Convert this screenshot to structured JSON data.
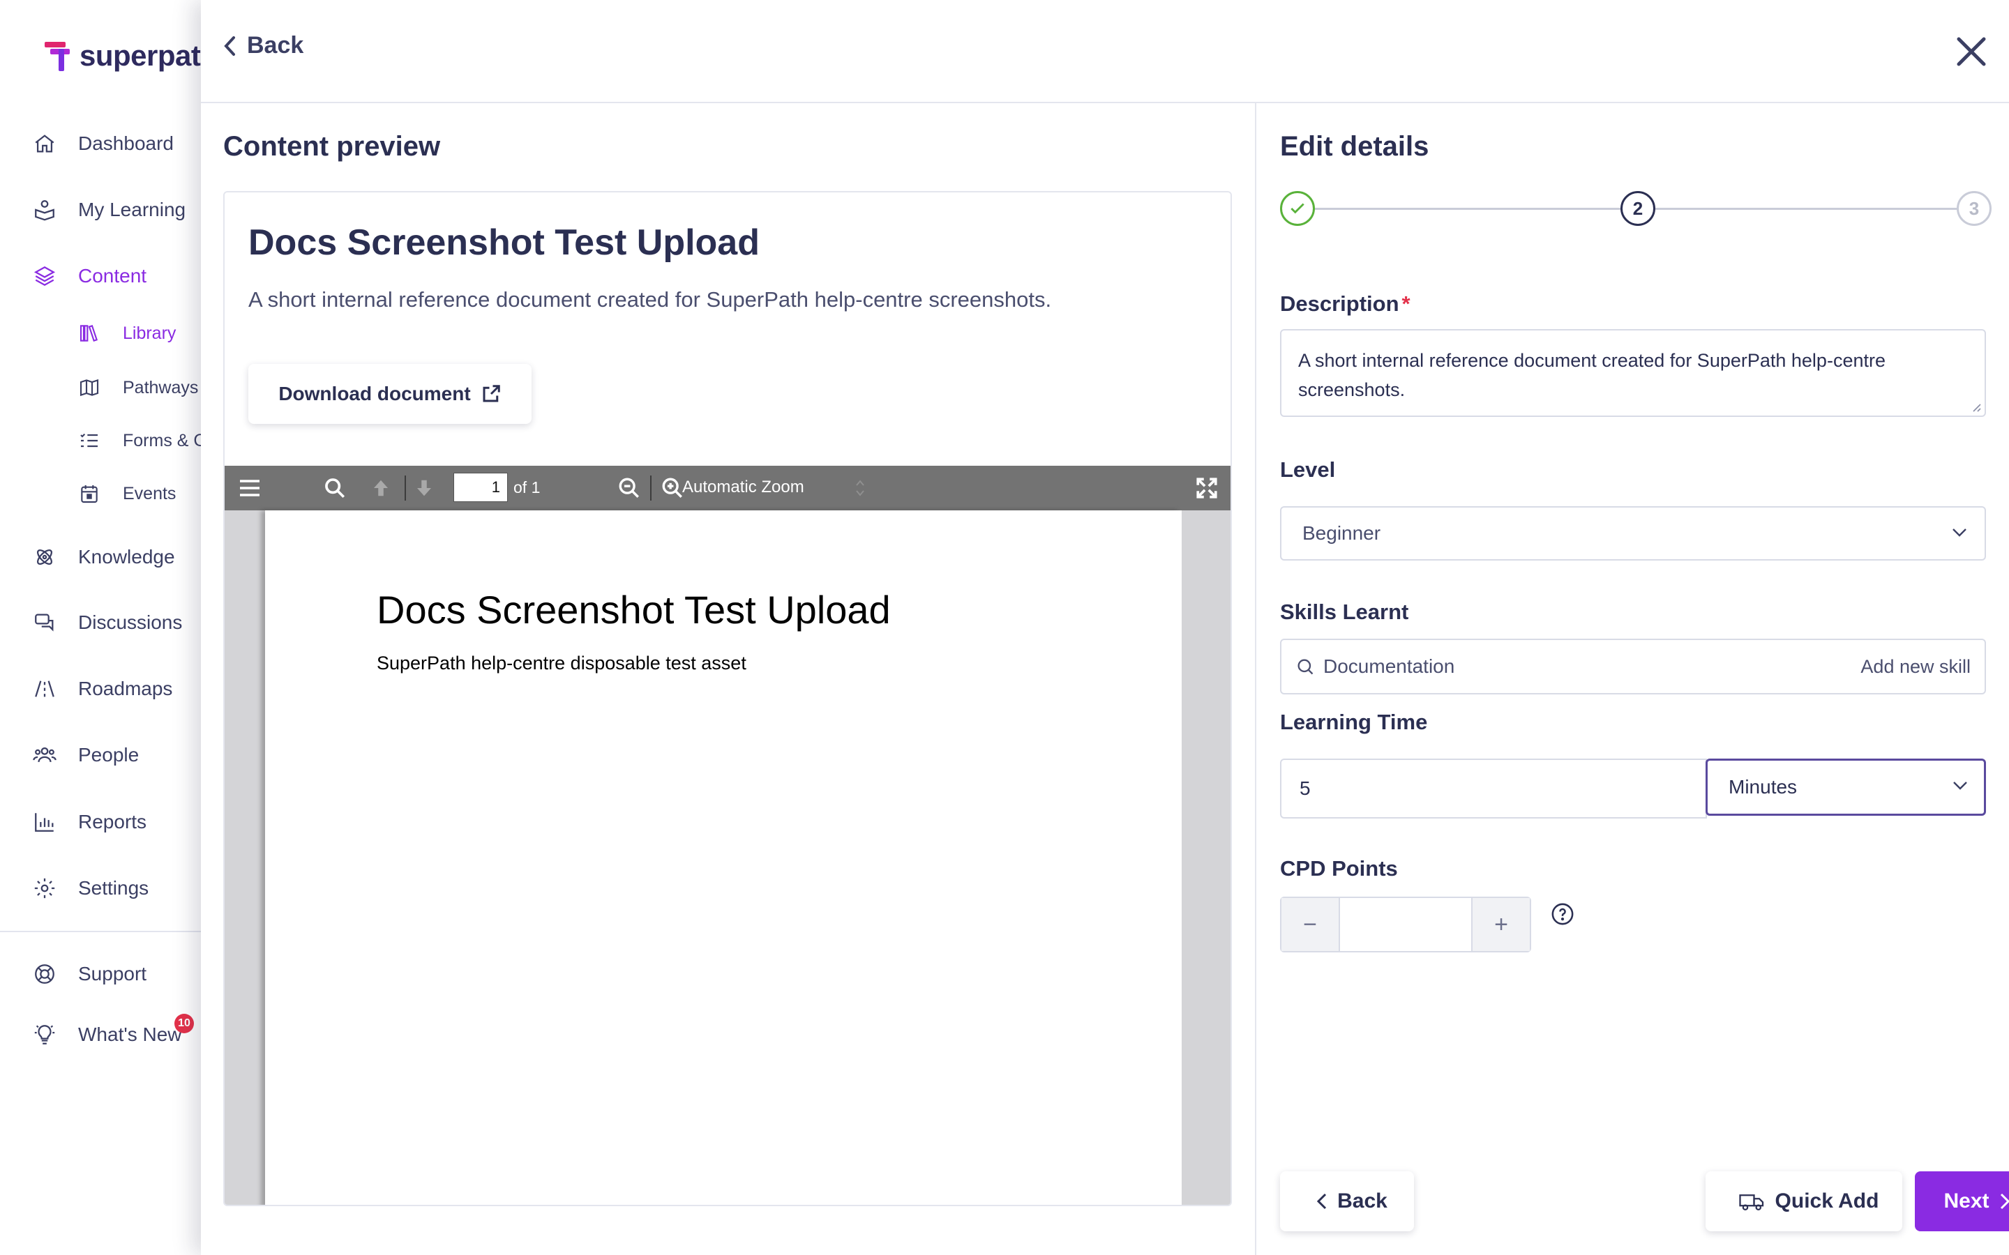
{
  "brand": {
    "name": "superpath",
    "accent": "#8a2be2"
  },
  "sidebar": {
    "items": [
      {
        "label": "Dashboard",
        "icon": "home-icon"
      },
      {
        "label": "My Learning",
        "icon": "learning-icon"
      },
      {
        "label": "Content",
        "icon": "layers-icon",
        "active": true
      },
      {
        "label": "Knowledge",
        "icon": "atom-icon"
      },
      {
        "label": "Discussions",
        "icon": "chat-icon"
      },
      {
        "label": "Roadmaps",
        "icon": "road-icon"
      },
      {
        "label": "People",
        "icon": "people-icon"
      },
      {
        "label": "Reports",
        "icon": "bar-chart-icon"
      },
      {
        "label": "Settings",
        "icon": "gear-icon"
      },
      {
        "label": "Support",
        "icon": "lifebuoy-icon"
      },
      {
        "label": "What's New",
        "icon": "lightbulb-icon"
      }
    ],
    "subitems": [
      {
        "label": "Library",
        "icon": "books-icon",
        "active": true
      },
      {
        "label": "Pathways",
        "icon": "map-icon"
      },
      {
        "label": "Forms & C",
        "icon": "list-icon"
      },
      {
        "label": "Events",
        "icon": "calendar-icon"
      }
    ],
    "whats_new_badge": "10"
  },
  "header": {
    "back_label": "Back"
  },
  "preview": {
    "title": "Content preview",
    "doc_title": "Docs Screenshot Test Upload",
    "doc_description": "A short internal reference document created for SuperPath help-centre screenshots.",
    "download_label": "Download document",
    "pdf": {
      "page_number": "1",
      "page_of": "of 1",
      "zoom": "Automatic Zoom",
      "page_title": "Docs Screenshot Test Upload",
      "page_subtitle": "SuperPath help-centre disposable test asset"
    }
  },
  "details": {
    "title": "Edit details",
    "steps": [
      {
        "label": "",
        "state": "done"
      },
      {
        "label": "2",
        "state": "current"
      },
      {
        "label": "3",
        "state": "upcoming"
      }
    ],
    "description_label": "Description",
    "description_required": "*",
    "description_value": "A short internal reference document created for SuperPath help-centre screenshots.",
    "level_label": "Level",
    "level_value": "Beginner",
    "skills_label": "Skills Learnt",
    "skills_value": "Documentation",
    "add_skill_label": "Add new skill",
    "time_label": "Learning Time",
    "time_value": "5",
    "time_unit": "Minutes",
    "cpd_label": "CPD Points",
    "cpd_minus": "−",
    "cpd_plus": "+",
    "cpd_value": ""
  },
  "footer": {
    "back_label": "Back",
    "quick_add_label": "Quick Add",
    "next_label": "Next"
  }
}
